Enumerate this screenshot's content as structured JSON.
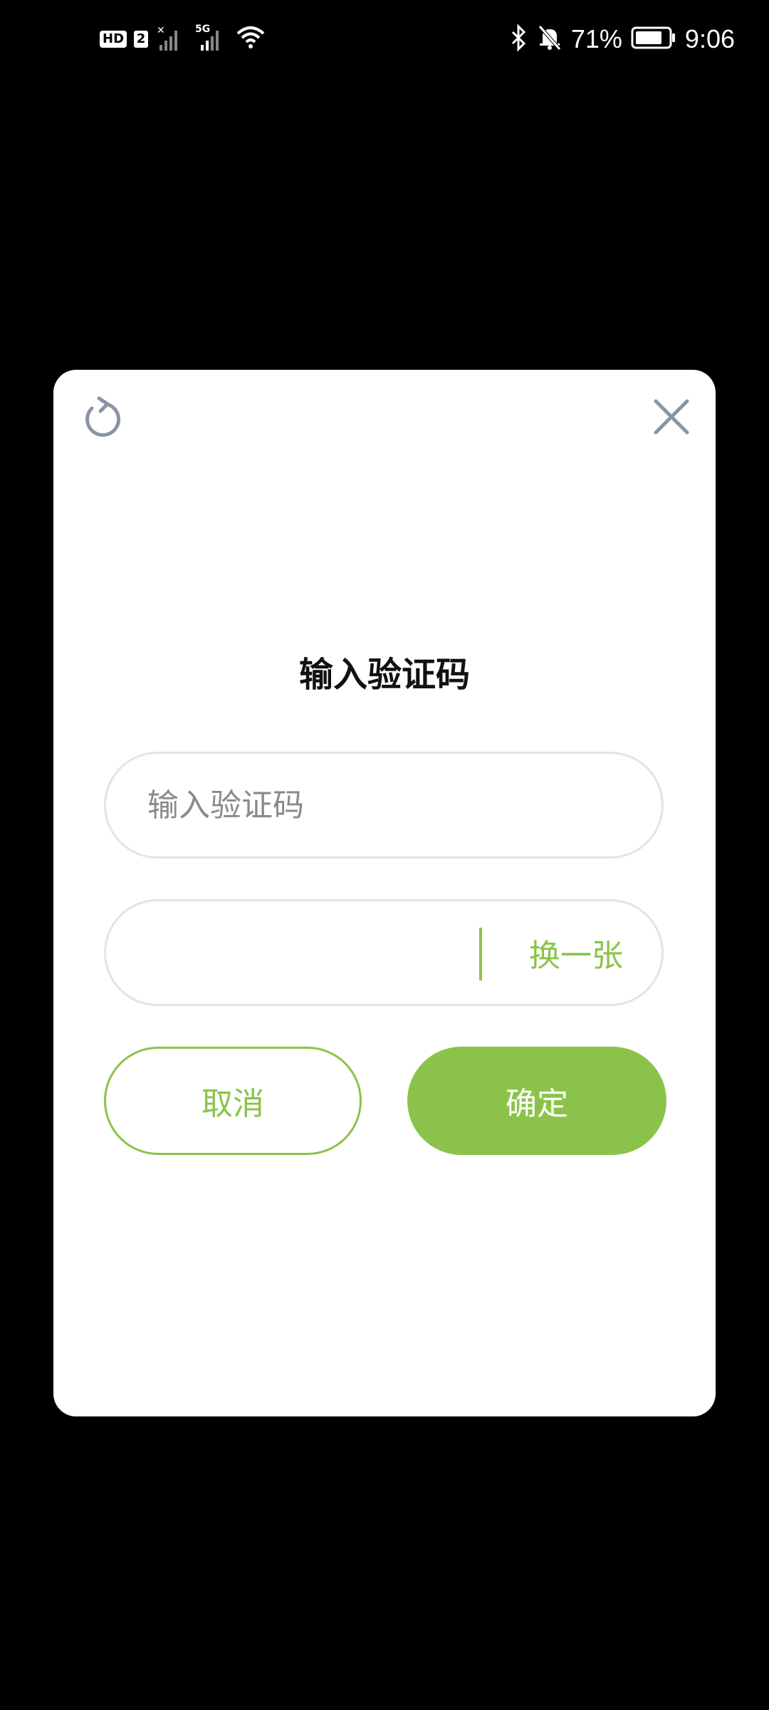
{
  "status_bar": {
    "hd_label": "HD",
    "sim_label": "2",
    "network_label": "5G",
    "battery_percent": "71%",
    "time": "9:06"
  },
  "dialog": {
    "title": "输入验证码",
    "refresh_icon": "refresh-icon",
    "close_icon": "close-icon",
    "code_input": {
      "value": "",
      "placeholder": "输入验证码"
    },
    "captcha_refresh_label": "换一张",
    "cancel_label": "取消",
    "confirm_label": "确定"
  },
  "colors": {
    "accent": "#8bc34a",
    "icon_gray": "#8a94a8",
    "border": "#e4e4e4",
    "background": "#000000",
    "dialog_bg": "#ffffff"
  }
}
